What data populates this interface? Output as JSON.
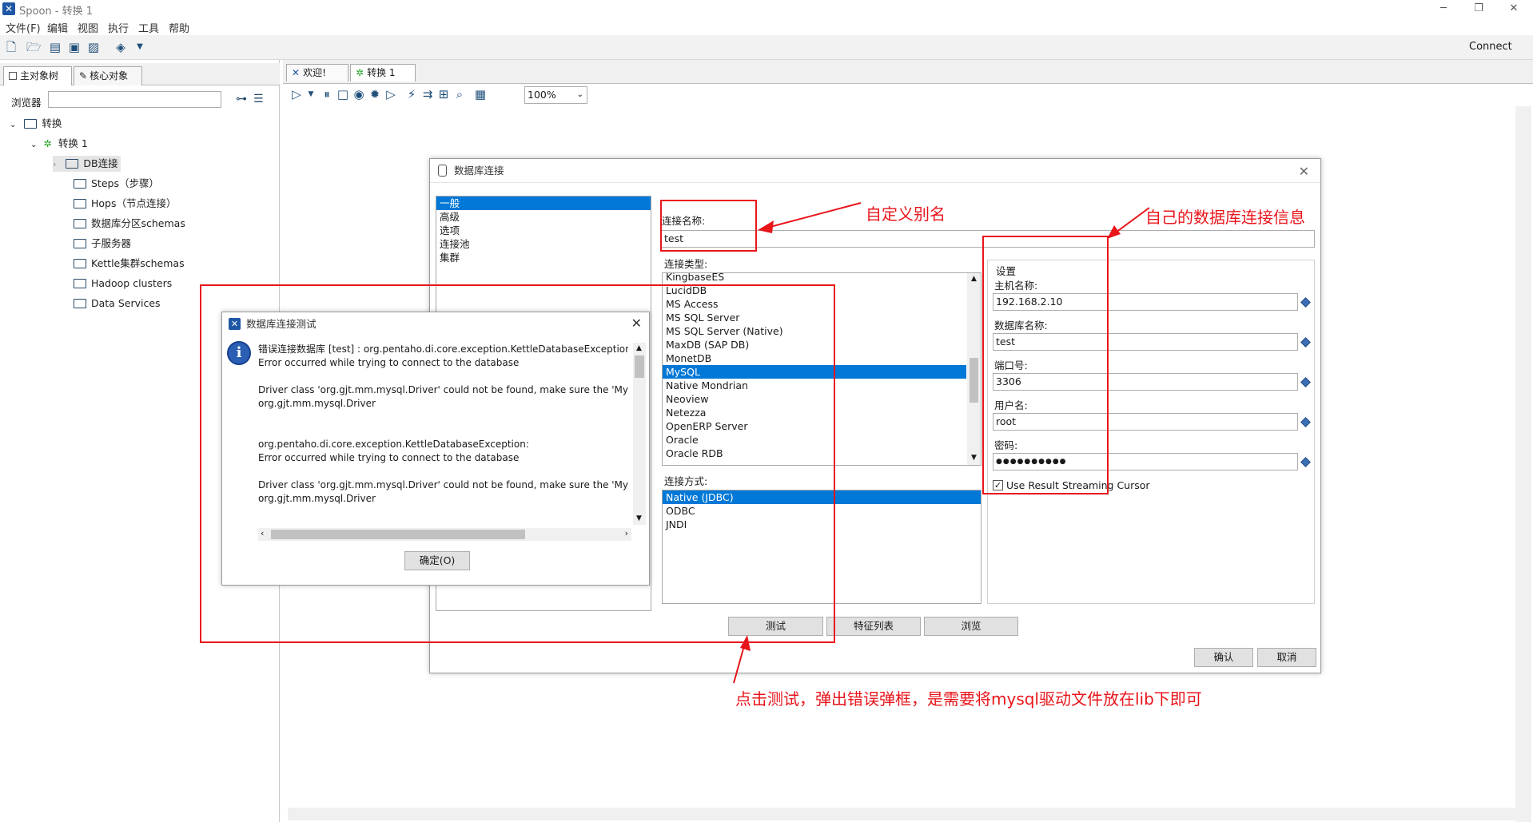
{
  "window": {
    "title": "Spoon - 转换 1"
  },
  "menu": [
    "文件(F)",
    "编辑",
    "视图",
    "执行",
    "工具",
    "帮助"
  ],
  "toolbar": {
    "connect_label": "Connect"
  },
  "left_panel": {
    "tabs": [
      "主对象树",
      "核心对象"
    ],
    "browser_label": "浏览器",
    "search_placeholder": "",
    "tree": {
      "root": "转换",
      "child": "转换 1",
      "items": [
        "DB连接",
        "Steps（步骤）",
        "Hops（节点连接）",
        "数据库分区schemas",
        "子服务器",
        "Kettle集群schemas",
        "Hadoop clusters",
        "Data Services"
      ]
    }
  },
  "editor": {
    "tabs": [
      "欢迎!",
      "转换 1"
    ],
    "zoom": "100%"
  },
  "db_dialog": {
    "title": "数据库连接",
    "nav_items": [
      "一般",
      "高级",
      "选项",
      "连接池",
      "集群"
    ],
    "conn_name_label": "连接名称:",
    "conn_name_value": "test",
    "conn_type_label": "连接类型:",
    "conn_types": [
      "KingbaseES",
      "LucidDB",
      "MS Access",
      "MS SQL Server",
      "MS SQL Server (Native)",
      "MaxDB (SAP DB)",
      "MonetDB",
      "MySQL",
      "Native Mondrian",
      "Neoview",
      "Netezza",
      "OpenERP Server",
      "Oracle",
      "Oracle RDB"
    ],
    "conn_type_selected": "MySQL",
    "access_label": "连接方式:",
    "access_types": [
      "Native (JDBC)",
      "ODBC",
      "JNDI"
    ],
    "access_selected": "Native (JDBC)",
    "settings_title": "设置",
    "host_label": "主机名称:",
    "host_value": "192.168.2.10",
    "dbname_label": "数据库名称:",
    "dbname_value": "test",
    "port_label": "端口号:",
    "port_value": "3306",
    "user_label": "用户名:",
    "user_value": "root",
    "password_label": "密码:",
    "password_value": "●●●●●●●●●●",
    "streaming_label": "Use Result Streaming Cursor",
    "buttons": {
      "test": "测试",
      "features": "特征列表",
      "browse": "浏览",
      "ok": "确认",
      "cancel": "取消"
    }
  },
  "error_dialog": {
    "title": "数据库连接测试",
    "lines": [
      "错误连接数据库 [test] : org.pentaho.di.core.exception.KettleDatabaseException:",
      "Error occurred while trying to connect to the database",
      "",
      "Driver class 'org.gjt.mm.mysql.Driver' could not be found, make sure the 'MySC",
      "org.gjt.mm.mysql.Driver",
      "",
      "",
      "org.pentaho.di.core.exception.KettleDatabaseException:",
      "Error occurred while trying to connect to the database",
      "",
      "Driver class 'org.gjt.mm.mysql.Driver' could not be found, make sure the 'MySC",
      "org.gjt.mm.mysql.Driver"
    ],
    "ok_label": "确定(O)"
  },
  "annotations": {
    "alias": "自定义别名",
    "conn_info": "自己的数据库连接信息",
    "tip": "点击测试，弹出错误弹框，是需要将mysql驱动文件放在lib下即可"
  },
  "colors": {
    "annotation_red": "#e8151b",
    "selection_blue": "#0078d7"
  }
}
